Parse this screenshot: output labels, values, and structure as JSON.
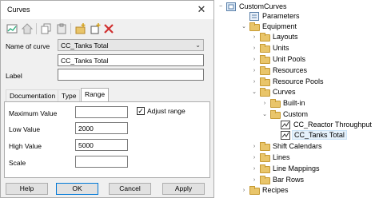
{
  "dialog": {
    "title": "Curves",
    "close_glyph": "✕",
    "toolbar_icons": [
      "curve-window-icon",
      "house-icon",
      "copy-icon",
      "paste-icon",
      "new-folder-icon",
      "new-item-icon",
      "delete-icon"
    ],
    "name_of_curve_label": "Name of curve",
    "name_combo_value": "CC_Tanks Total",
    "name_field_value": "CC_Tanks Total",
    "label_label": "Label",
    "label_value": "",
    "tabs": [
      "Documentation",
      "Type",
      "Range"
    ],
    "active_tab": "Range",
    "range": {
      "max_label": "Maximum Value",
      "max_value": "",
      "adjust_range_label": "Adjust range",
      "adjust_range_checked": true,
      "low_label": "Low Value",
      "low_value": "2000",
      "high_label": "High Value",
      "high_value": "5000",
      "scale_label": "Scale",
      "scale_value": ""
    },
    "buttons": {
      "help": "Help",
      "ok": "OK",
      "cancel": "Cancel",
      "apply": "Apply"
    }
  },
  "tree": {
    "nodes": [
      {
        "label": "CustomCurves",
        "icon": "model-icon",
        "expander": "−"
      },
      {
        "label": "Parameters",
        "icon": "parameters-icon",
        "expander": ""
      },
      {
        "label": "Equipment",
        "icon": "folder-icon",
        "expander": "⌄"
      },
      {
        "label": "Layouts",
        "icon": "folder-icon",
        "expander": "›"
      },
      {
        "label": "Units",
        "icon": "folder-icon",
        "expander": "›"
      },
      {
        "label": "Unit Pools",
        "icon": "folder-icon",
        "expander": "›"
      },
      {
        "label": "Resources",
        "icon": "folder-icon",
        "expander": "›"
      },
      {
        "label": "Resource Pools",
        "icon": "folder-icon",
        "expander": "›"
      },
      {
        "label": "Curves",
        "icon": "folder-icon",
        "expander": "⌄"
      },
      {
        "label": "Built-in",
        "icon": "folder-icon",
        "expander": "›"
      },
      {
        "label": "Custom",
        "icon": "folder-icon",
        "expander": "⌄"
      },
      {
        "label": "CC_Reactor Throughput",
        "icon": "curve-icon",
        "expander": ""
      },
      {
        "label": "CC_Tanks Total",
        "icon": "curve-icon",
        "expander": "",
        "selected": true
      },
      {
        "label": "Shift Calendars",
        "icon": "folder-icon",
        "expander": "›"
      },
      {
        "label": "Lines",
        "icon": "folder-icon",
        "expander": "›"
      },
      {
        "label": "Line Mappings",
        "icon": "folder-icon",
        "expander": "›"
      },
      {
        "label": "Bar Rows",
        "icon": "folder-icon",
        "expander": "›"
      },
      {
        "label": "Recipes",
        "icon": "folder-icon",
        "expander": "›"
      }
    ]
  },
  "colors": {
    "folder": "#e9c56a",
    "selection": "#e5f1fb",
    "delete_red": "#d03030",
    "accent": "#0078d7"
  }
}
